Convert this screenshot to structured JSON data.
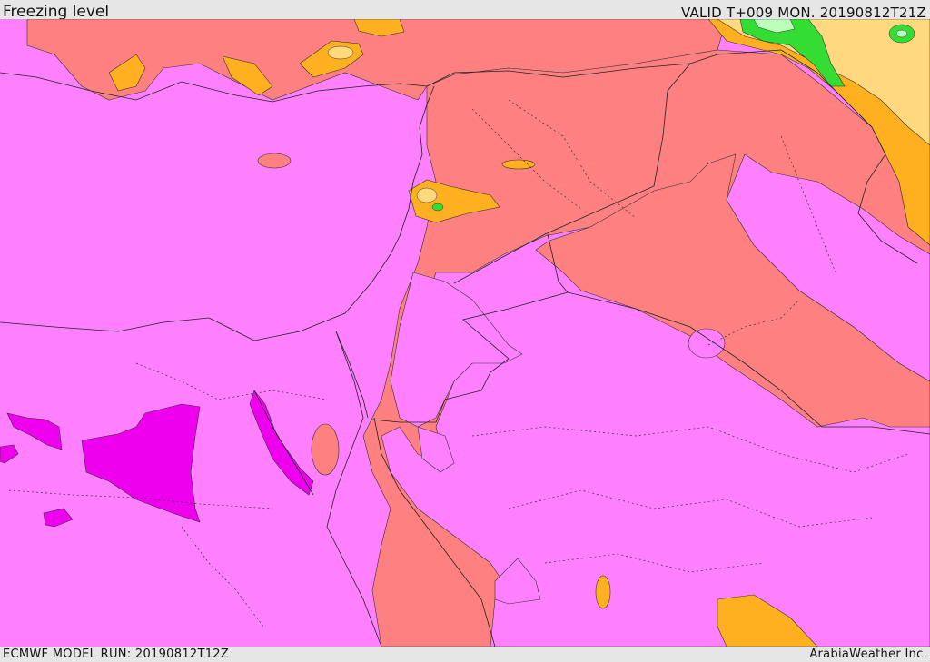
{
  "header": {
    "title": "Freezing level",
    "valid": "VALID T+009 MON. 20190812T21Z"
  },
  "footer": {
    "model_run": "ECMWF MODEL RUN: 20190812T12Z",
    "credit": "ArabiaWeather Inc."
  },
  "palette": {
    "magenta_dark": "#ee00ee",
    "magenta": "#ff80ff",
    "salmon": "#ff8080",
    "orange": "#ffb020",
    "light_orange": "#ffd880",
    "green": "#33dd33",
    "light_green": "#bbffbb",
    "border_line": "#222222",
    "map_background": "#e6e6e6"
  }
}
